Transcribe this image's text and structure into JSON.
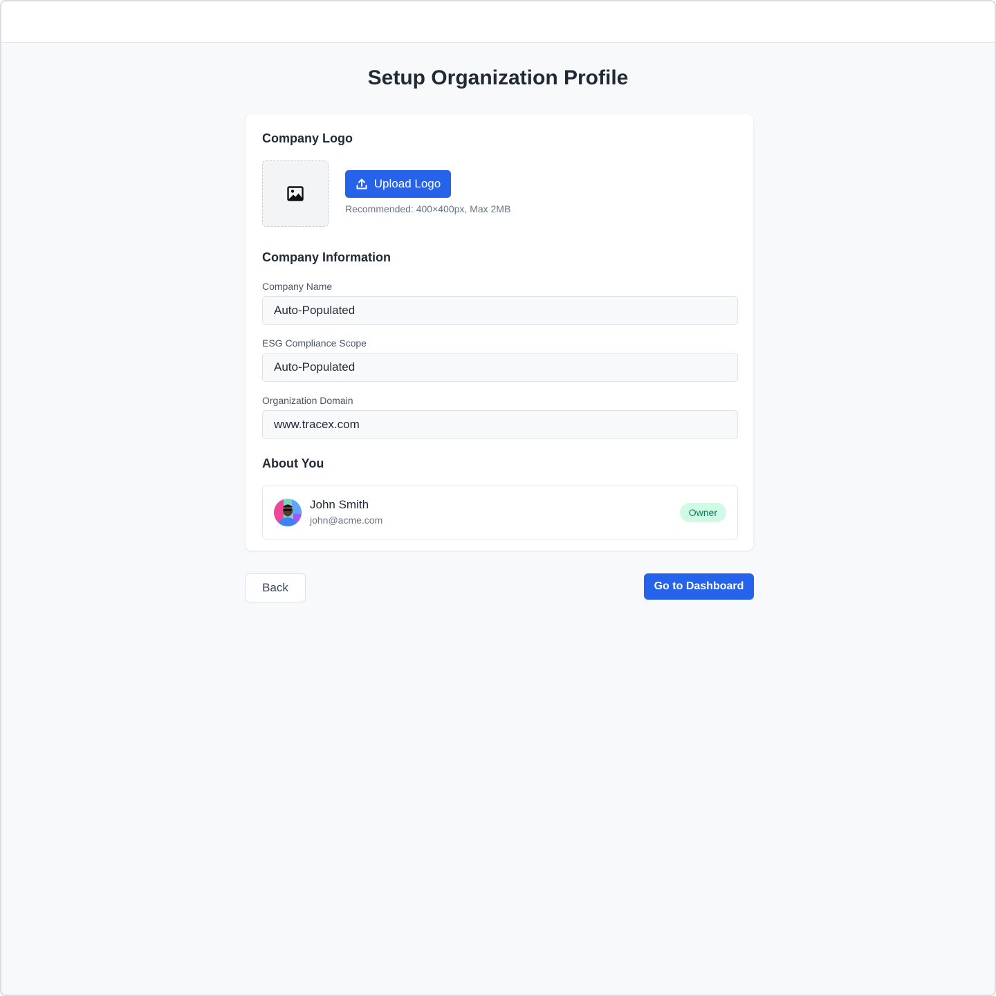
{
  "page": {
    "title": "Setup Organization Profile"
  },
  "logo_section": {
    "title": "Company Logo",
    "placeholder_icon": "image-icon",
    "upload_label": "Upload Logo",
    "upload_icon": "upload-icon",
    "hint": "Recommended: 400×400px, Max 2MB"
  },
  "company_info": {
    "title": "Company Information",
    "fields": [
      {
        "label": "Company Name",
        "value": "Auto-Populated"
      },
      {
        "label": "ESG Compliance Scope",
        "value": "Auto-Populated"
      },
      {
        "label": "Organization Domain",
        "value": "www.tracex.com"
      }
    ]
  },
  "about_you": {
    "title": "About You",
    "user": {
      "name": "John Smith",
      "email": "john@acme.com",
      "role": "Owner"
    }
  },
  "actions": {
    "back_label": "Back",
    "primary_label": "Go to Dashboard"
  },
  "colors": {
    "primary": "#2563eb",
    "badge_bg": "#d1fae5",
    "badge_text": "#047857",
    "text_dark": "#1f2937",
    "page_bg": "#f8f9fb"
  }
}
